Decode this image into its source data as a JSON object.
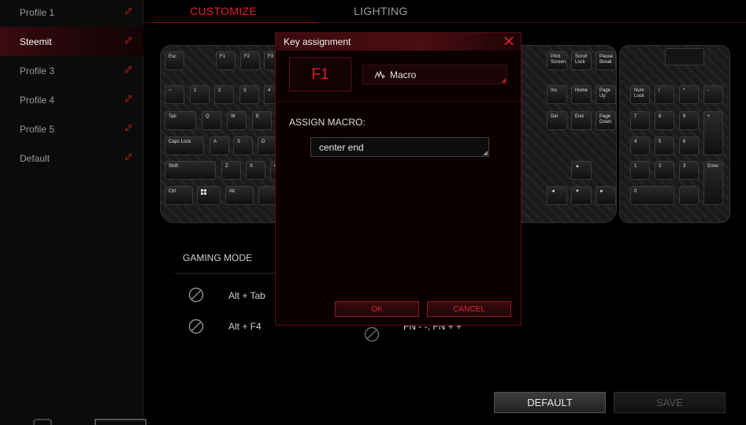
{
  "sidebar": {
    "profiles": [
      {
        "label": "Profile 1",
        "active": false
      },
      {
        "label": "Steemit",
        "active": true
      },
      {
        "label": "Profile 3",
        "active": false
      },
      {
        "label": "Profile 4",
        "active": false
      },
      {
        "label": "Profile 5",
        "active": false
      },
      {
        "label": "Default",
        "active": false
      }
    ]
  },
  "tabs": {
    "customize": "CUSTOMIZE",
    "lighting": "LIGHTING"
  },
  "keyboard": {
    "keys": [
      "Esc",
      "F1",
      "F2",
      "F3",
      "Print Screen",
      "Scroll Lock",
      "Pause Break",
      "~",
      "1",
      "2",
      "3",
      "4",
      "Tab",
      "Q",
      "W",
      "E",
      "Caps Lock",
      "A",
      "S",
      "D",
      "Shift",
      "Z",
      "X",
      "C",
      "Ctrl",
      "Alt",
      "Ins",
      "Home",
      "Page Up",
      "Del",
      "End",
      "Page Down",
      "Num Lock",
      "/",
      "*",
      "-",
      "7",
      "8",
      "9",
      "+",
      "4",
      "5",
      "6",
      "1",
      "2",
      "3",
      "Enter",
      "0",
      ".",
      "◄",
      "▼",
      "►",
      "▲"
    ]
  },
  "gaming_mode": {
    "title": "GAMING MODE",
    "items": [
      "Alt + Tab",
      "Alt + F4"
    ],
    "item3": "FN - -, FN + +"
  },
  "buttons": {
    "default": "DEFAULT",
    "save": "SAVE"
  },
  "dialog": {
    "title": "Key assignment",
    "key": "F1",
    "type": "Macro",
    "assign_label": "ASSIGN MACRO:",
    "macro_value": "center end",
    "ok": "OK",
    "cancel": "CANCEL"
  },
  "colors": {
    "accent": "#e0202a",
    "background": "#000000",
    "dialog_border": "#5a1016"
  }
}
